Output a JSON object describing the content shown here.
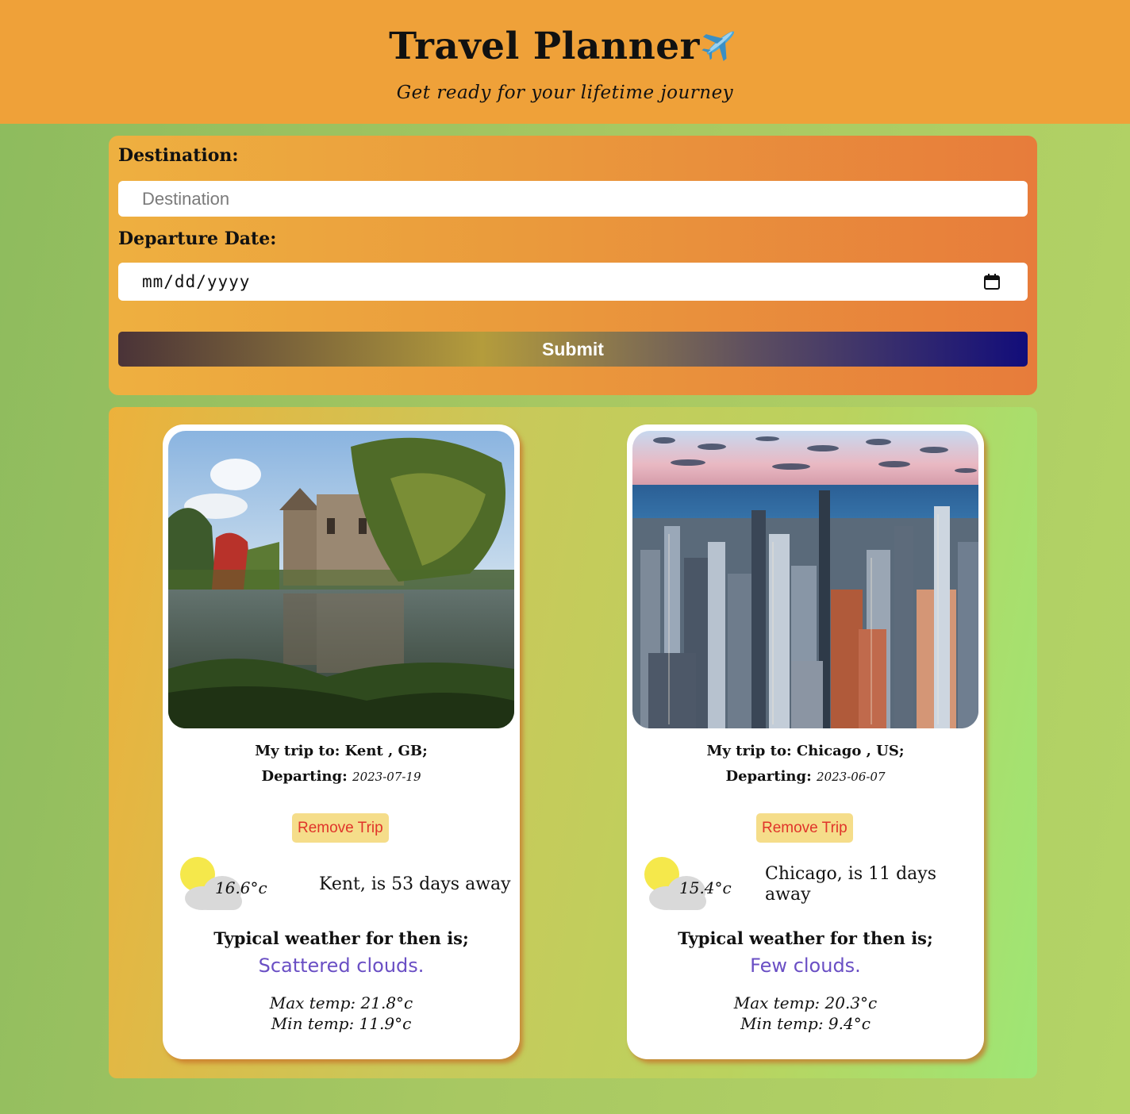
{
  "header": {
    "title": "Travel Planner",
    "title_icon": "airplane-icon",
    "subtitle": "Get ready for your lifetime journey"
  },
  "form": {
    "destination_label": "Destination:",
    "destination_placeholder": "Destination",
    "destination_value": "",
    "date_label": "Departure Date:",
    "date_placeholder": "mm/dd/yyyy",
    "submit_label": "Submit"
  },
  "trips": [
    {
      "trip_prefix": "My trip to:",
      "destination": "Kent , GB;",
      "departing_label": "Departing:",
      "departing_date": "2023-07-19",
      "remove_label": "Remove Trip",
      "weather_icon": "sun-behind-cloud-icon",
      "current_temp": "16.6°c",
      "countdown": "Kent, is 53 days away",
      "typical_label": "Typical weather for then is;",
      "description": "Scattered clouds.",
      "max_temp": "Max temp: 21.8°c",
      "min_temp": "Min temp:  11.9°c"
    },
    {
      "trip_prefix": "My trip to:",
      "destination": "Chicago , US;",
      "departing_label": "Departing:",
      "departing_date": "2023-06-07",
      "remove_label": "Remove Trip",
      "weather_icon": "sun-behind-cloud-icon",
      "current_temp": "15.4°c",
      "countdown": "Chicago, is 11 days away",
      "typical_label": "Typical weather for then is;",
      "description": "Few clouds.",
      "max_temp": "Max temp: 20.3°c",
      "min_temp": "Min temp:  9.4°c"
    }
  ],
  "colors": {
    "header_bg": "#efa139",
    "remove_bg": "#f5dd8a",
    "remove_text": "#e0342a",
    "description_text": "#6a4fc4"
  }
}
